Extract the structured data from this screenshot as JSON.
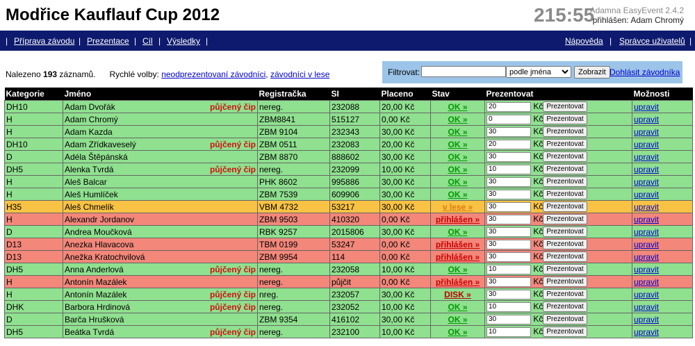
{
  "header": {
    "title": "Modřice Kauflauf Cup 2012",
    "clock": "215:55",
    "app": "Adamna EasyEvent 2.4.2",
    "user": "přihlášen: Adam Chromý"
  },
  "nav": {
    "sep": "|",
    "items": [
      "Příprava závodu",
      "Prezentace",
      "Cíl",
      "Výsledky"
    ],
    "right": [
      "Nápověda",
      "Správce uživatelů"
    ]
  },
  "info": {
    "found_prefix": "Nalezeno",
    "found_count": "193",
    "found_suffix": "záznamů.",
    "quick": "Rychlé volby:",
    "link1": "neodprezentovaní závodníci",
    "comma": ",",
    "link2": "závodníci v lese"
  },
  "filter": {
    "label": "Filtrovat:",
    "value": "",
    "select": "podle jména",
    "button": "Zobrazit",
    "link": "Dohlásit závodníka"
  },
  "table": {
    "headers": [
      "Kategorie",
      "Jméno",
      "Registračka",
      "SI",
      "Placeno",
      "Stav",
      "Prezentovat",
      "Možnosti"
    ],
    "currency": "Kč",
    "prez_button": "Prezentovat",
    "edit": "upravit",
    "rows": [
      {
        "cat": "DH10",
        "name": "Adam Dvořák",
        "chip": "půjčený čip",
        "reg": "nereg.",
        "si": "232088",
        "paid": "20,00 Kč",
        "stav": "OK »",
        "stav_type": "ok",
        "prez": "20",
        "color": "green"
      },
      {
        "cat": "H",
        "name": "Adam Chromý",
        "chip": "",
        "reg": "ZBM8841",
        "si": "515127",
        "paid": "0,00 Kč",
        "stav": "OK »",
        "stav_type": "ok",
        "prez": "0",
        "color": "green"
      },
      {
        "cat": "H",
        "name": "Adam Kazda",
        "chip": "",
        "reg": "ZBM 9104",
        "si": "232343",
        "paid": "30,00 Kč",
        "stav": "OK »",
        "stav_type": "ok",
        "prez": "30",
        "color": "green"
      },
      {
        "cat": "DH10",
        "name": "Adam Zřídkaveselý",
        "chip": "půjčený čip",
        "reg": "ZBM 0511",
        "si": "232083",
        "paid": "20,00 Kč",
        "stav": "OK »",
        "stav_type": "ok",
        "prez": "20",
        "color": "green"
      },
      {
        "cat": "D",
        "name": "Adéla Štěpánská",
        "chip": "",
        "reg": "ZBM 8870",
        "si": "888602",
        "paid": "30,00 Kč",
        "stav": "OK »",
        "stav_type": "ok",
        "prez": "30",
        "color": "green"
      },
      {
        "cat": "DH5",
        "name": "Alenka Tvrdá",
        "chip": "půjčený čip",
        "reg": "nereg.",
        "si": "232099",
        "paid": "10,00 Kč",
        "stav": "OK »",
        "stav_type": "ok",
        "prez": "10",
        "color": "green"
      },
      {
        "cat": "H",
        "name": "Aleš Balcar",
        "chip": "",
        "reg": "PHK 8602",
        "si": "995886",
        "paid": "30,00 Kč",
        "stav": "OK »",
        "stav_type": "ok",
        "prez": "30",
        "color": "green"
      },
      {
        "cat": "H",
        "name": "Aleš Humlíček",
        "chip": "",
        "reg": "ZBM 7539",
        "si": "609906",
        "paid": "30,00 Kč",
        "stav": "OK »",
        "stav_type": "ok",
        "prez": "30",
        "color": "green"
      },
      {
        "cat": "H35",
        "name": "Aleš Chmelík",
        "chip": "",
        "reg": "VBM 4732",
        "si": "53217",
        "paid": "30,00 Kč",
        "stav": "v lese »",
        "stav_type": "vl",
        "prez": "30",
        "color": "orange"
      },
      {
        "cat": "H",
        "name": "Alexandr Jordanov",
        "chip": "",
        "reg": "ZBM 9503",
        "si": "410320",
        "paid": "0,00 Kč",
        "stav": "přihlášen »",
        "stav_type": "pr",
        "prez": "30",
        "color": "red"
      },
      {
        "cat": "D",
        "name": "Andrea Moučková",
        "chip": "",
        "reg": "RBK 9257",
        "si": "2015806",
        "paid": "30,00 Kč",
        "stav": "OK »",
        "stav_type": "ok",
        "prez": "30",
        "color": "green"
      },
      {
        "cat": "D13",
        "name": "Anezka Hlavacova",
        "chip": "",
        "reg": "TBM 0199",
        "si": "53247",
        "paid": "0,00 Kč",
        "stav": "přihlášen »",
        "stav_type": "pr",
        "prez": "30",
        "color": "red"
      },
      {
        "cat": "D13",
        "name": "Anežka Kratochvilová",
        "chip": "",
        "reg": "ZBM 9954",
        "si": "114",
        "paid": "0,00 Kč",
        "stav": "přihlášen »",
        "stav_type": "pr",
        "prez": "30",
        "color": "red"
      },
      {
        "cat": "DH5",
        "name": "Anna Anderlová",
        "chip": "půjčený čip",
        "reg": "nereg.",
        "si": "232058",
        "paid": "10,00 Kč",
        "stav": "OK »",
        "stav_type": "ok",
        "prez": "10",
        "color": "green"
      },
      {
        "cat": "H",
        "name": "Antonín Mazálek",
        "chip": "",
        "reg": "nereg.",
        "si": "půjčit",
        "paid": "0,00 Kč",
        "stav": "přihlášen »",
        "stav_type": "pr",
        "prez": "30",
        "color": "red"
      },
      {
        "cat": "H",
        "name": "Antonín Mazálek",
        "chip": "půjčený čip",
        "reg": "nreg.",
        "si": "232057",
        "paid": "30,00 Kč",
        "stav": "DISK »",
        "stav_type": "ds",
        "prez": "30",
        "color": "green"
      },
      {
        "cat": "DHK",
        "name": "Barbora Hrdinová",
        "chip": "půjčený čip",
        "reg": "nereg.",
        "si": "232052",
        "paid": "10,00 Kč",
        "stav": "OK »",
        "stav_type": "ok",
        "prez": "10",
        "color": "green"
      },
      {
        "cat": "D",
        "name": "Barča Hrušková",
        "chip": "",
        "reg": "ZBM 9354",
        "si": "416102",
        "paid": "30,00 Kč",
        "stav": "OK »",
        "stav_type": "ok",
        "prez": "30",
        "color": "green"
      },
      {
        "cat": "DH5",
        "name": "Beátka Tvrdá",
        "chip": "půjčený čip",
        "reg": "nereg.",
        "si": "232100",
        "paid": "10,00 Kč",
        "stav": "OK »",
        "stav_type": "ok",
        "prez": "10",
        "color": "green"
      }
    ]
  }
}
